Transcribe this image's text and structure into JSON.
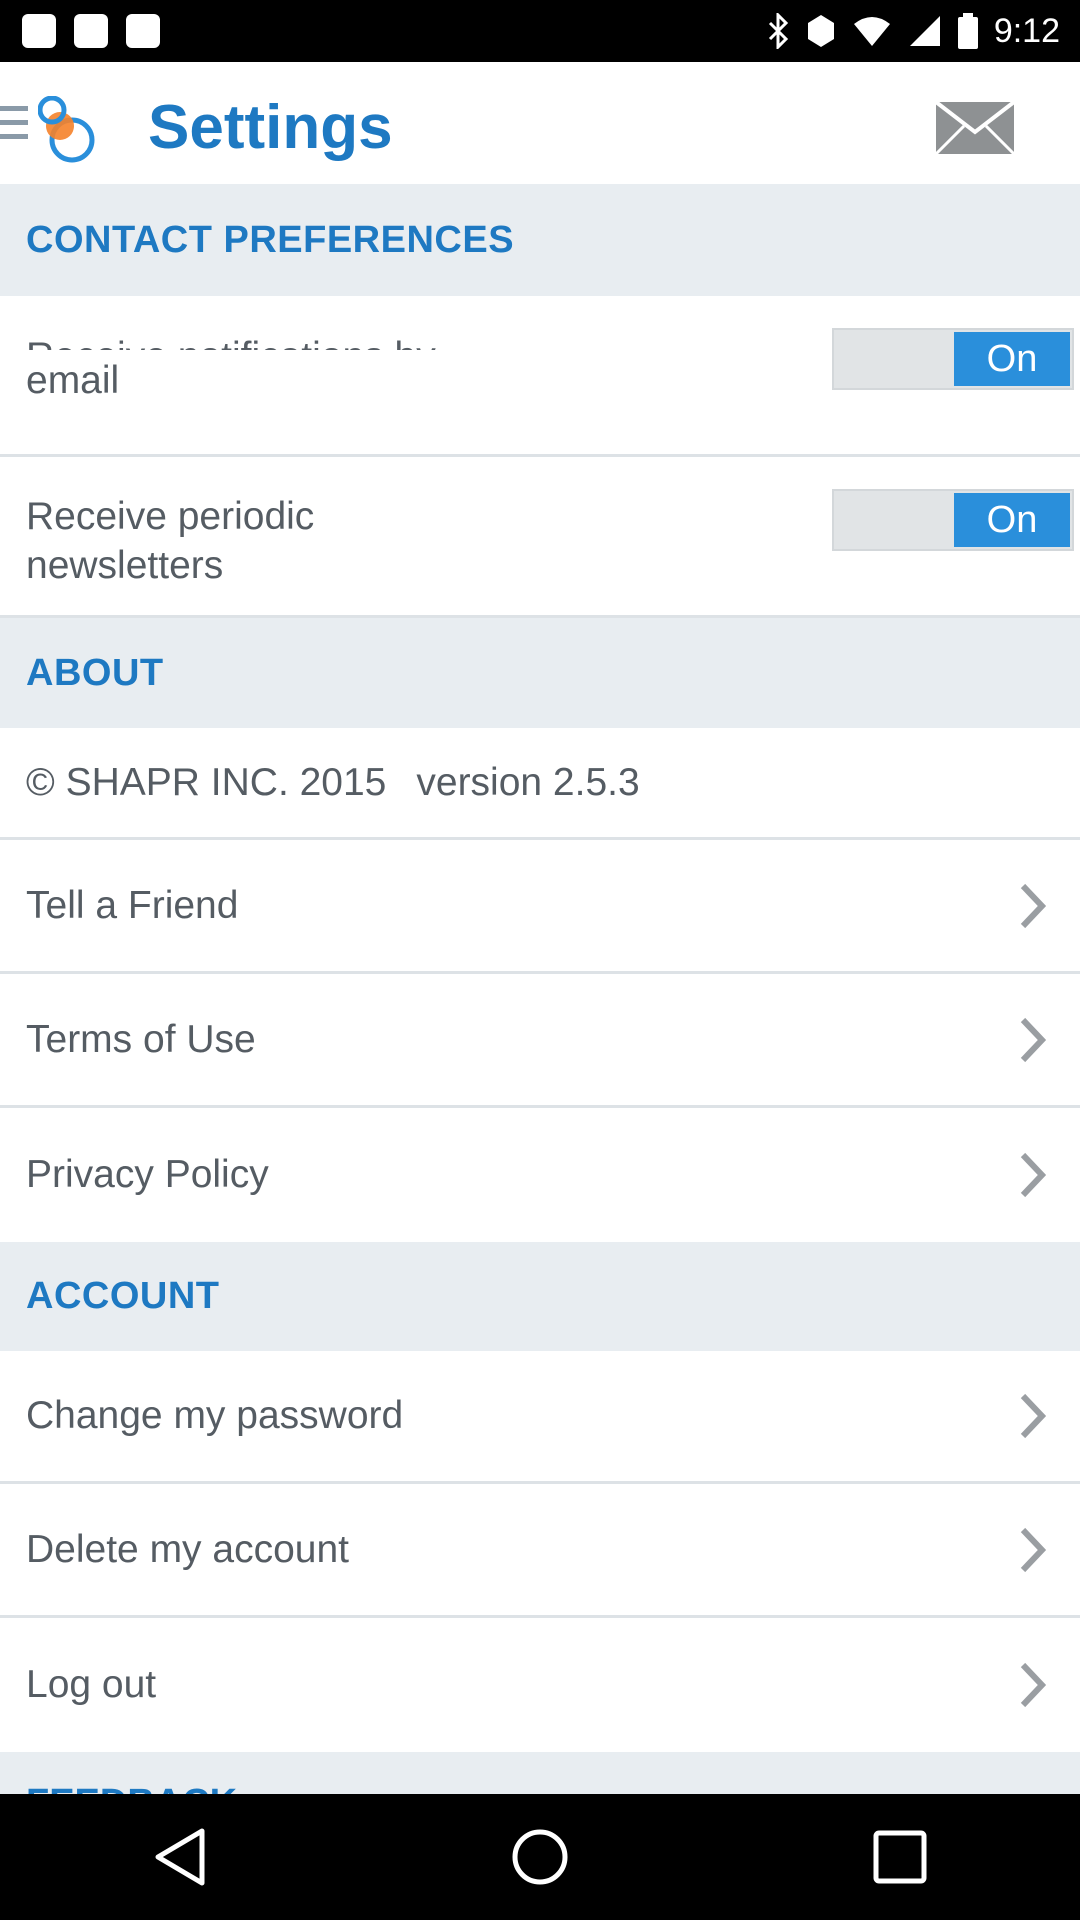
{
  "status_bar": {
    "time": "9:12"
  },
  "header": {
    "title": "Settings"
  },
  "contact_preferences": {
    "title": "CONTACT PREFERENCES",
    "items": [
      {
        "label_line1": "Receive notifications by",
        "label_line2": "email",
        "toggle": "On"
      },
      {
        "label_line1": "Receive periodic",
        "label_line2": "newsletters",
        "toggle": "On"
      }
    ]
  },
  "about": {
    "title": "ABOUT",
    "copyright": "© SHAPR INC. 2015",
    "version": "version 2.5.3",
    "items": [
      "Tell a Friend",
      "Terms of Use",
      "Privacy Policy"
    ]
  },
  "account": {
    "title": "ACCOUNT",
    "items": [
      "Change my password",
      "Delete my account",
      "Log out"
    ]
  },
  "feedback": {
    "title": "FEEDBACK"
  },
  "colors": {
    "accent": "#1e79c2",
    "toggle_on": "#2a8fdb",
    "section_bg": "#e8edf1"
  },
  "icons": [
    "menu-icon",
    "shapr-logo-icon",
    "mail-icon",
    "chevron-right-icon",
    "back-icon",
    "home-icon",
    "recents-icon"
  ]
}
